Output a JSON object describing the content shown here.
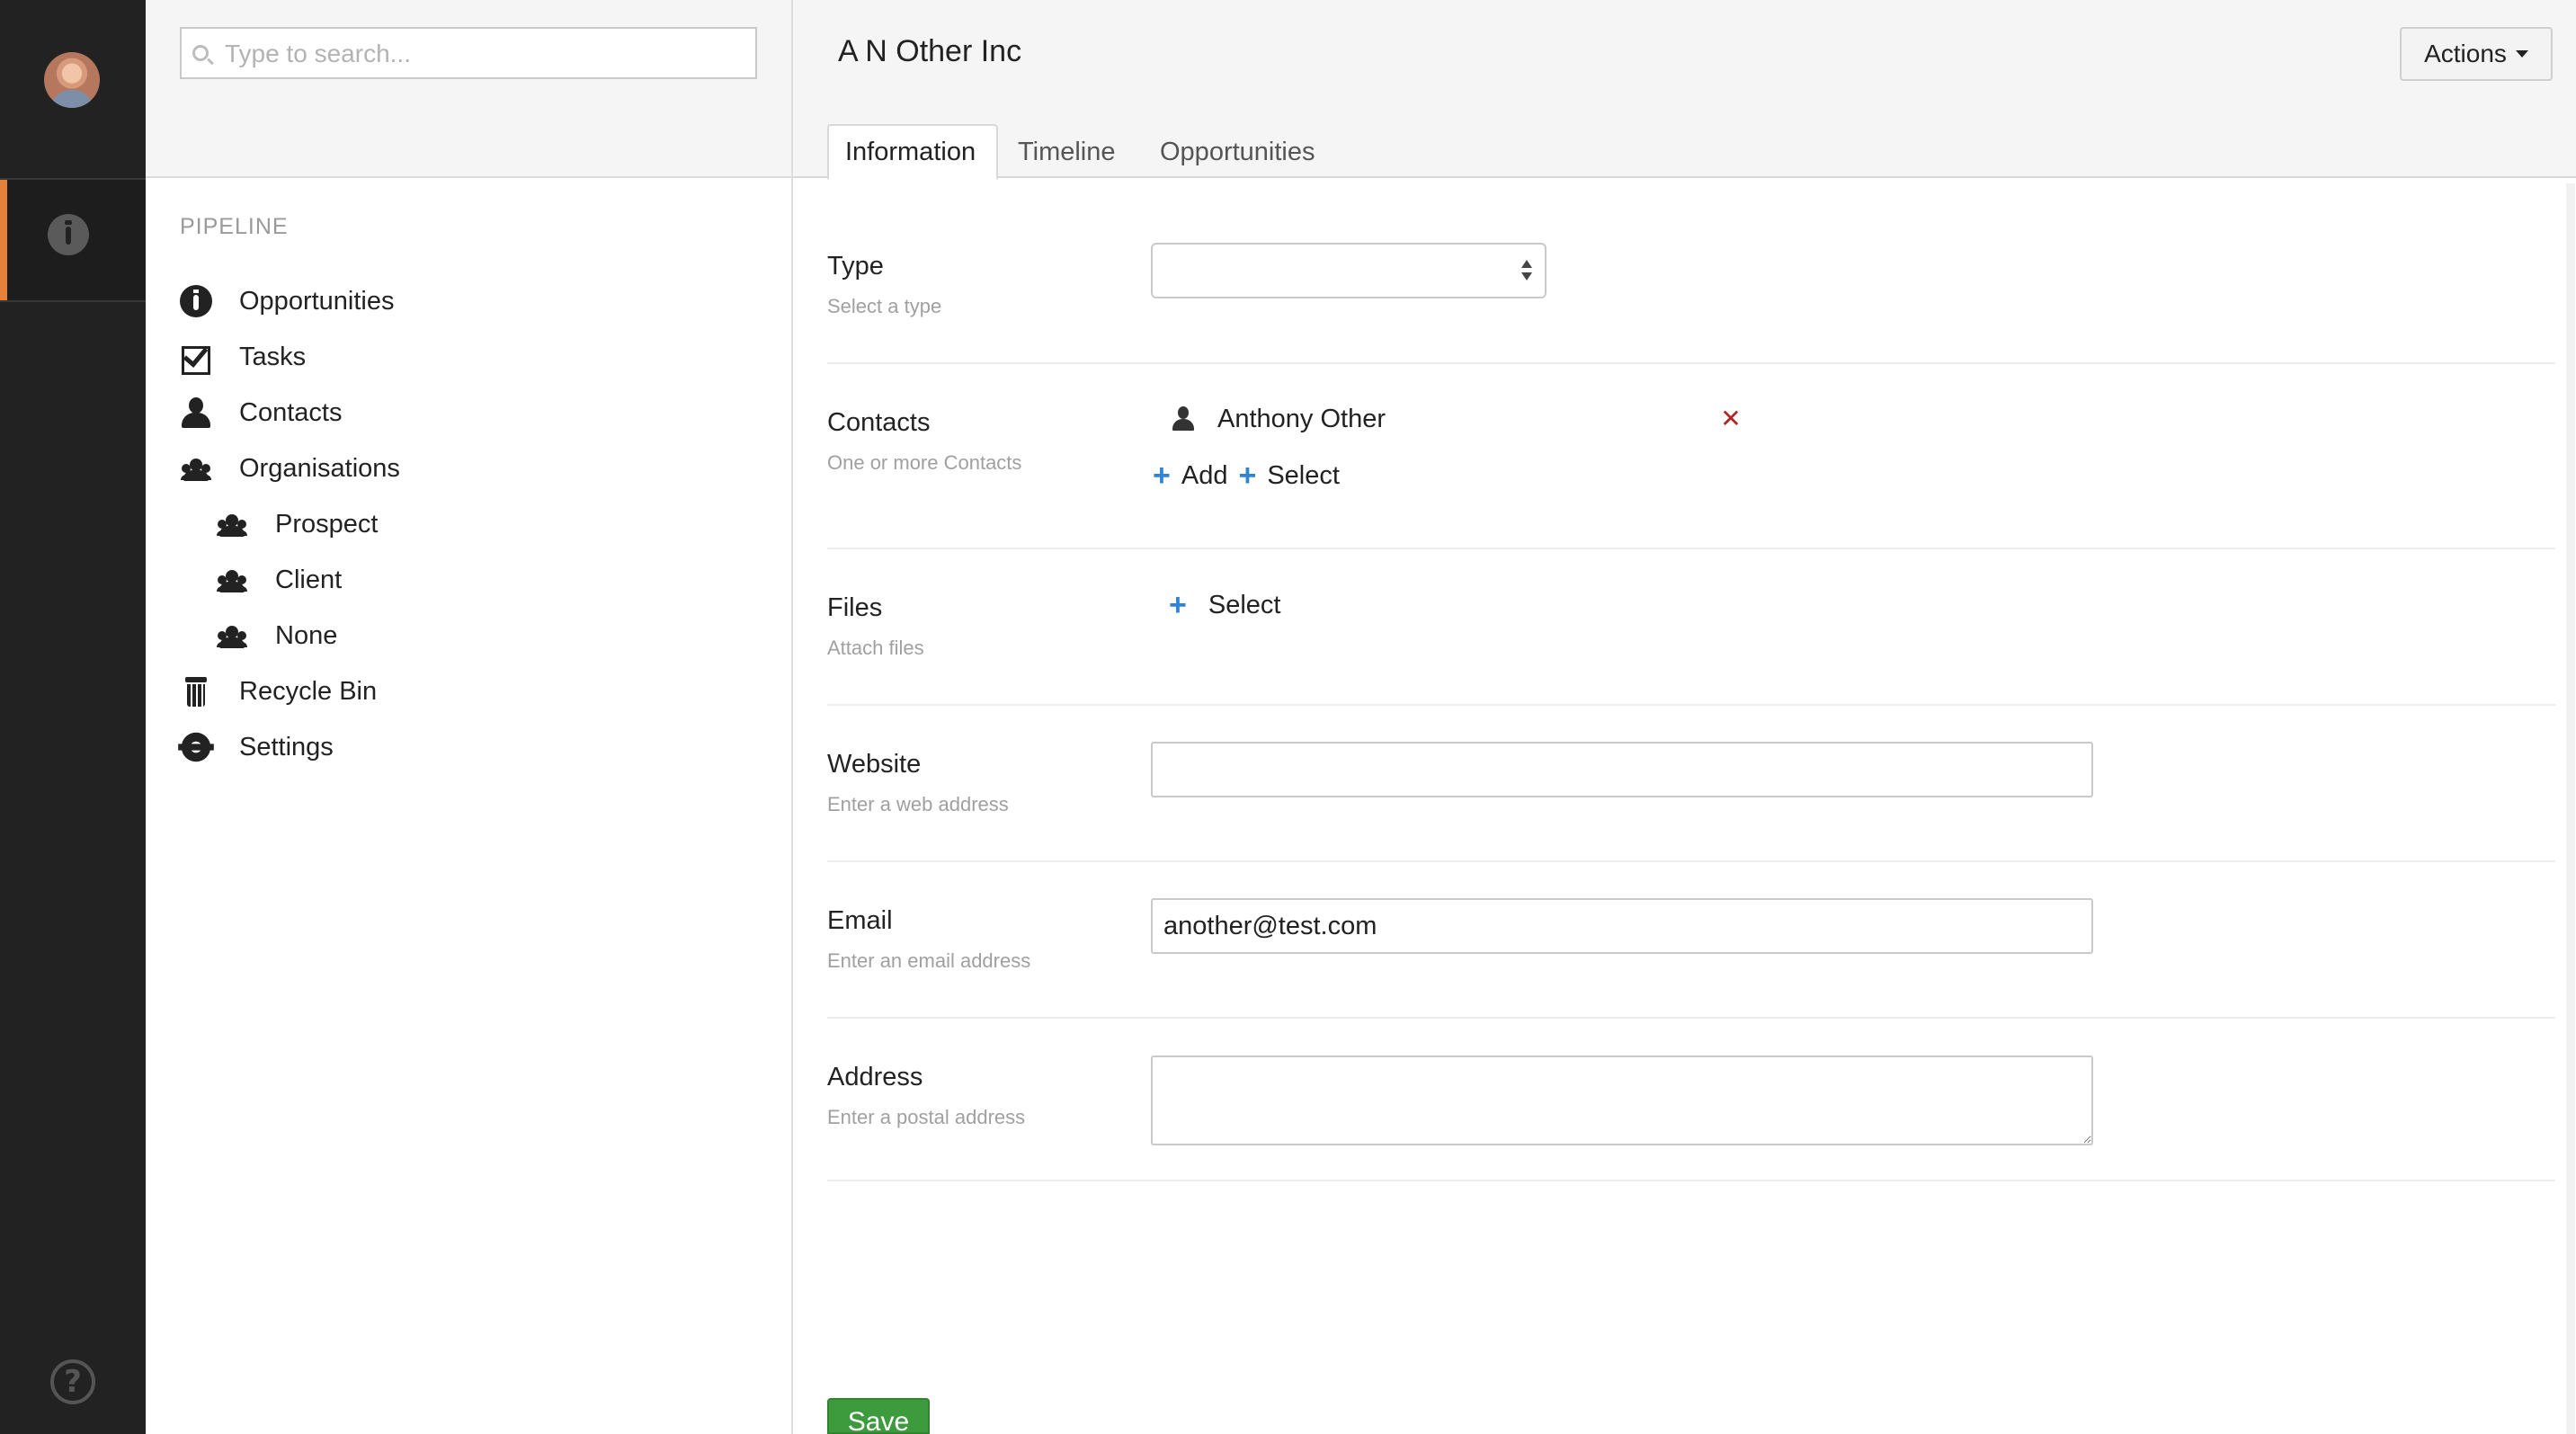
{
  "search": {
    "placeholder": "Type to search..."
  },
  "nav": {
    "heading": "PIPELINE",
    "items": [
      {
        "label": "Opportunities",
        "icon": "gauge-icon"
      },
      {
        "label": "Tasks",
        "icon": "checkbox-icon"
      },
      {
        "label": "Contacts",
        "icon": "user-icon"
      },
      {
        "label": "Organisations",
        "icon": "group-icon"
      },
      {
        "label": "Prospect",
        "icon": "group-icon"
      },
      {
        "label": "Client",
        "icon": "group-icon"
      },
      {
        "label": "None",
        "icon": "group-icon"
      },
      {
        "label": "Recycle Bin",
        "icon": "trash-icon"
      },
      {
        "label": "Settings",
        "icon": "gear-icon"
      }
    ]
  },
  "header": {
    "title": "A N Other Inc",
    "actions_label": "Actions"
  },
  "tabs": [
    {
      "label": "Information",
      "active": true
    },
    {
      "label": "Timeline",
      "active": false
    },
    {
      "label": "Opportunities",
      "active": false
    }
  ],
  "form": {
    "type": {
      "label": "Type",
      "help": "Select a type",
      "value": ""
    },
    "contacts": {
      "label": "Contacts",
      "help": "One or more Contacts",
      "items": [
        "Anthony Other"
      ],
      "add_label": "Add",
      "select_label": "Select"
    },
    "files": {
      "label": "Files",
      "help": "Attach files",
      "select_label": "Select"
    },
    "website": {
      "label": "Website",
      "help": "Enter a web address",
      "value": ""
    },
    "email": {
      "label": "Email",
      "help": "Enter an email address",
      "value": "another@test.com"
    },
    "address": {
      "label": "Address",
      "help": "Enter a postal address",
      "value": ""
    },
    "save_label": "Save"
  },
  "colors": {
    "rail": "#222222",
    "accent": "#e5813a",
    "link_plus": "#2f83d6",
    "remove": "#b22222",
    "save": "#3d9a3d"
  }
}
